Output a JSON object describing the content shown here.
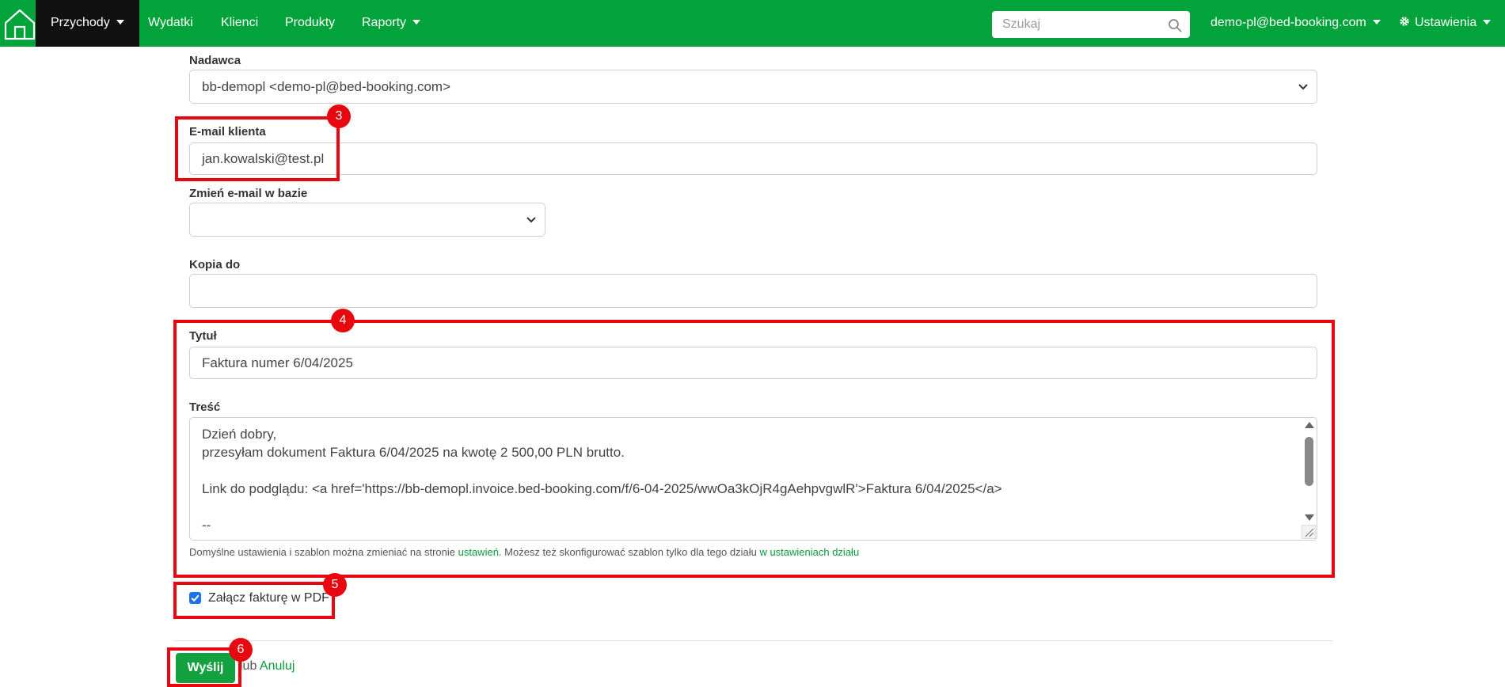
{
  "nav": {
    "items": [
      {
        "label": "Przychody",
        "active": true,
        "dropdown": true
      },
      {
        "label": "Wydatki"
      },
      {
        "label": "Klienci"
      },
      {
        "label": "Produkty"
      },
      {
        "label": "Raporty",
        "dropdown": true
      }
    ],
    "search": {
      "placeholder": "Szukaj",
      "value": ""
    },
    "user": {
      "label": "demo-pl@bed-booking.com",
      "dropdown": true
    },
    "settings": {
      "label": "Ustawienia",
      "dropdown": true
    },
    "colors": {
      "bar": "#01a33a",
      "active": "#111111"
    }
  },
  "form": {
    "sender": {
      "label": "Nadawca",
      "value": "bb-demopl <demo-pl@bed-booking.com>"
    },
    "client_email": {
      "label": "E-mail klienta",
      "value": "jan.kowalski@test.pl"
    },
    "change_email": {
      "label": "Zmień e-mail w bazie",
      "value": ""
    },
    "cc": {
      "label": "Kopia do",
      "value": ""
    },
    "title": {
      "label": "Tytuł",
      "value": "Faktura numer 6/04/2025"
    },
    "body": {
      "label": "Treść",
      "lines": [
        "Dzień dobry,",
        "przesyłam dokument Faktura 6/04/2025 na kwotę 2 500,00 PLN brutto.",
        "",
        "Link do podglądu: <a href='https://bb-demopl.invoice.bed-booking.com/f/6-04-2025/wwOa3kOjR4gAehpvgwlR'>Faktura 6/04/2025</a>",
        "",
        "--"
      ]
    },
    "hint": {
      "part1": "Domyślne ustawienia i szablon można zmieniać na stronie ",
      "link1": "ustawień",
      "part2": ". Możesz też skonfigurować szablon tylko dla tego działu ",
      "link2": "w ustawieniach działu"
    },
    "attach_pdf": {
      "label": "Załącz fakturę w PDF",
      "checked": true
    },
    "send_label": "Wyślij",
    "or_text": "lub",
    "cancel_label": "Anuluj"
  },
  "annotations": {
    "color": "#e8060f",
    "badges": [
      "3",
      "4",
      "5",
      "6"
    ]
  }
}
